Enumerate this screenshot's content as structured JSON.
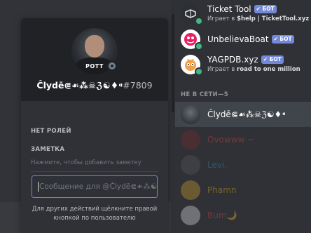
{
  "colors": {
    "accent": "#7289da",
    "online": "#43b581",
    "offline_status": "#747f8d"
  },
  "profile": {
    "shirt_text": "POTT",
    "username": "Ĉlydē⋐☙⁂☠ℨ☯♦⁌",
    "discriminator": "#7809",
    "roles_title": "НЕТ РОЛЕЙ",
    "note_title": "ЗАМЕТКА",
    "note_placeholder": "Нажмите, чтобы добавить заметку",
    "message_placeholder": "Сообщение для @Ĉlydē⋐☙⁂☯",
    "hint": "Для других действий щёлкните правой кнопкой по пользователю"
  },
  "members": {
    "online": [
      {
        "name": "Ticket Tool",
        "badge": "✔ БОТ",
        "activity_prefix": "Играет в ",
        "activity_game": "$help | TicketTool.xyz",
        "avatar_icon": "ticket-tool-icon"
      },
      {
        "name": "UnbelievaBoat",
        "badge": "✔ БОТ",
        "avatar_icon": "unbelievaboat-icon"
      },
      {
        "name": "YAGPDB.xyz",
        "badge": "✔ БОТ",
        "activity_prefix": "Играет в ",
        "activity_game": "road to one million",
        "avatar_icon": "yagpdb-icon"
      }
    ],
    "offline_header": "НЕ В СЕТИ—5",
    "offline": [
      {
        "name": "Ĉlydē⋐☙⁂☠ℨ☯♦⁌",
        "color": "#ffffff"
      },
      {
        "name": "Ovowww ~",
        "color": "#f04747"
      },
      {
        "name": "Levi.",
        "color": "#3498db"
      },
      {
        "name": "Phamn",
        "color": "#f1c40f"
      },
      {
        "name": "Bum🌙",
        "color": "#f04747"
      }
    ]
  }
}
